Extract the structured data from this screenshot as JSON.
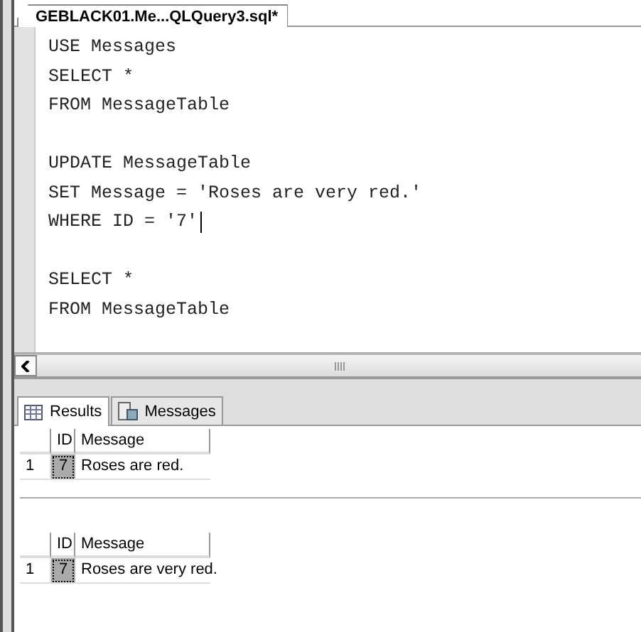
{
  "editor_tab": {
    "title": "GEBLACK01.Me...QLQuery3.sql*"
  },
  "code_blocks": [
    {
      "lines": [
        {
          "text": "USE Messages",
          "cursor": false
        },
        {
          "text": "SELECT *",
          "cursor": false
        },
        {
          "text": "FROM MessageTable",
          "cursor": false
        }
      ]
    },
    {
      "lines": [
        {
          "text": "UPDATE MessageTable",
          "cursor": false
        },
        {
          "text": "SET Message = 'Roses are very red.'",
          "cursor": false
        },
        {
          "text": "WHERE ID = '7'",
          "cursor": true
        }
      ]
    },
    {
      "lines": [
        {
          "text": "SELECT *",
          "cursor": false
        },
        {
          "text": "FROM MessageTable",
          "cursor": false
        }
      ]
    }
  ],
  "result_tabs": [
    {
      "label": "Results",
      "selected": true
    },
    {
      "label": "Messages",
      "selected": false
    }
  ],
  "grids": [
    {
      "columns": [
        "ID",
        "Message"
      ],
      "rows": [
        {
          "row_number": "1",
          "cells": [
            {
              "text": "7",
              "selected": true
            },
            {
              "text": "Roses are red.",
              "selected": false
            }
          ]
        }
      ]
    },
    {
      "columns": [
        "ID",
        "Message"
      ],
      "rows": [
        {
          "row_number": "1",
          "cells": [
            {
              "text": "7",
              "selected": true
            },
            {
              "text": "Roses are very red.",
              "selected": false
            }
          ]
        }
      ]
    }
  ]
}
